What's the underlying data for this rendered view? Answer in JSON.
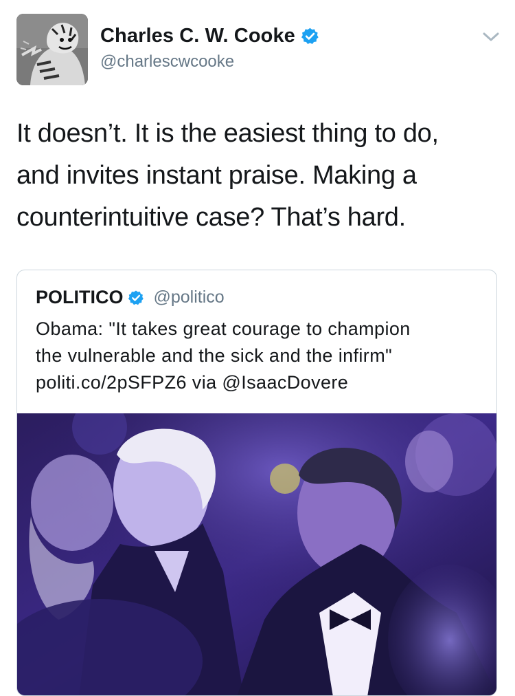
{
  "author": {
    "display_name": "Charles C. W. Cooke",
    "handle": "@charlescwcooke",
    "verified": true,
    "avatar_icon": "tiger-cartoon-avatar"
  },
  "tweet": {
    "lines": [
      "It doesn’t. It is the easiest thing to do,",
      "and invites instant praise. Making a",
      "counterintuitive case? That’s hard."
    ]
  },
  "quoted": {
    "display_name": "POLITICO",
    "handle": "@politico",
    "verified": true,
    "lines": [
      "Obama: \"It takes great courage to champion",
      "the vulnerable and the sick and the infirm\"",
      "politi.co/2pSFPZ6 via @IsaacDovere"
    ],
    "media_icon": "event-audience-photo"
  },
  "colors": {
    "verified_blue": "#1da1f2",
    "secondary_text": "#657786",
    "border": "#ccd6dd",
    "photo_tint": "#5b3fc4"
  }
}
